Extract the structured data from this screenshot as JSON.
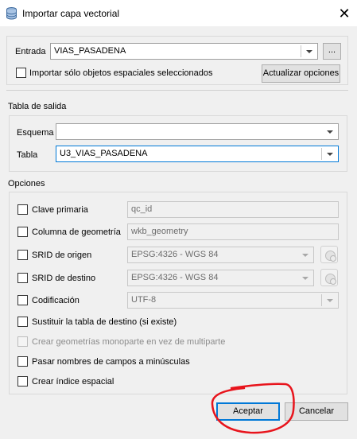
{
  "window": {
    "title": "Importar capa vectorial",
    "close_glyph": "✕"
  },
  "input": {
    "label": "Entrada",
    "value": "VIAS_PASADENA",
    "browse_label": "...",
    "only_selected_label": "Importar sólo objetos espaciales seleccionados",
    "update_options_label": "Actualizar opciones"
  },
  "output": {
    "section_label": "Tabla de salida",
    "schema_label": "Esquema",
    "schema_value": "",
    "table_label": "Tabla",
    "table_value": "U3_VIAS_PASADENA"
  },
  "options": {
    "section_label": "Opciones",
    "primary_key_label": "Clave primaria",
    "primary_key_value": "qc_id",
    "geometry_column_label": "Columna de geometría",
    "geometry_column_value": "wkb_geometry",
    "source_srid_label": "SRID de origen",
    "source_srid_value": "EPSG:4326 - WGS 84",
    "target_srid_label": "SRID de destino",
    "target_srid_value": "EPSG:4326 - WGS 84",
    "encoding_label": "Codificación",
    "encoding_value": "UTF-8",
    "replace_table_label": "Sustituir la tabla de destino (si existe)",
    "singlepart_label": "Crear geometrías monoparte en vez de multiparte",
    "lowercase_label": "Pasar nombres de campos a minúsculas",
    "spatial_index_label": "Crear índice espacial"
  },
  "buttons": {
    "accept": "Aceptar",
    "cancel": "Cancelar"
  },
  "colors": {
    "annotation": "#e8141c",
    "focus": "#0078d7"
  }
}
